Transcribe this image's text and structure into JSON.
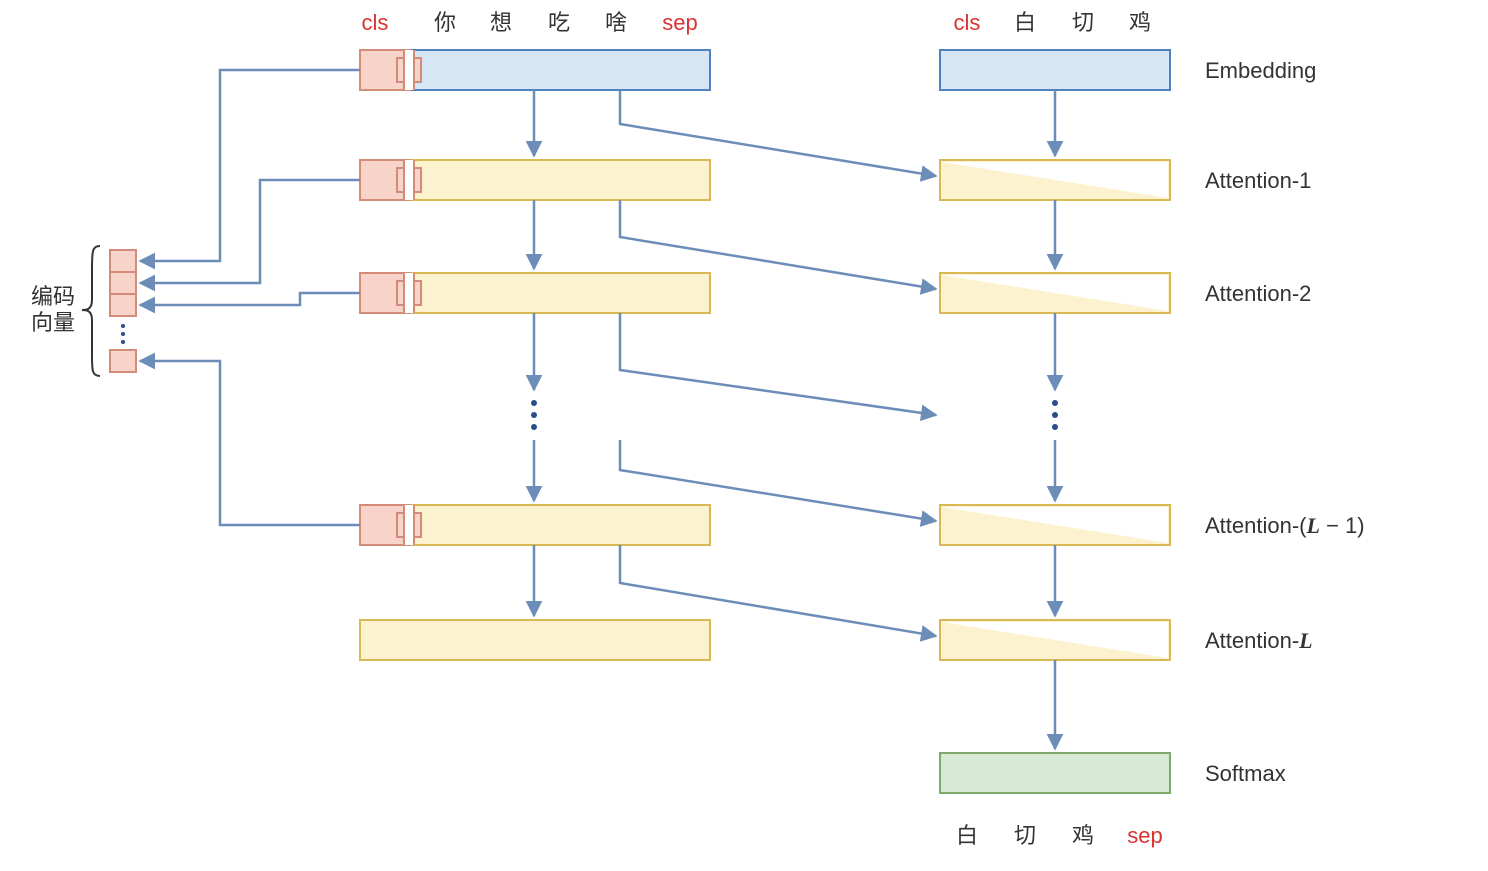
{
  "colors": {
    "blue": "#d6e6f5",
    "blueStroke": "#4f81bd",
    "yel": "#fdf2cf",
    "yelStroke": "#d8b954",
    "pnk": "#f8d3ca",
    "pnkStroke": "#d38b7a",
    "grn": "#d6ead3",
    "grnStroke": "#7fa86b",
    "arrow": "#6b8db8",
    "tokenRed": "#d93333",
    "tokenGrey": "#333333"
  },
  "inputTokens": {
    "t0": "cls",
    "t1": "你",
    "t2": "想",
    "t3": "吃",
    "t4": "啥",
    "t5": "sep"
  },
  "decoderInputTokens": {
    "t0": "cls",
    "t1": "白",
    "t2": "切",
    "t3": "鸡"
  },
  "outputTokens": {
    "t0": "白",
    "t1": "切",
    "t2": "鸡",
    "t3": "sep"
  },
  "labels": {
    "embedding": "Embedding",
    "attn1": "Attention-1",
    "attn2": "Attention-2",
    "attnLm1_prefix": "Attention-(",
    "attnLm1_L": "L",
    "attnLm1_minus": " − 1)",
    "attnL_prefix": "Attention-",
    "attnL_L": "L",
    "softmax": "Softmax",
    "encVec1": "编码",
    "encVec2": "向量"
  }
}
